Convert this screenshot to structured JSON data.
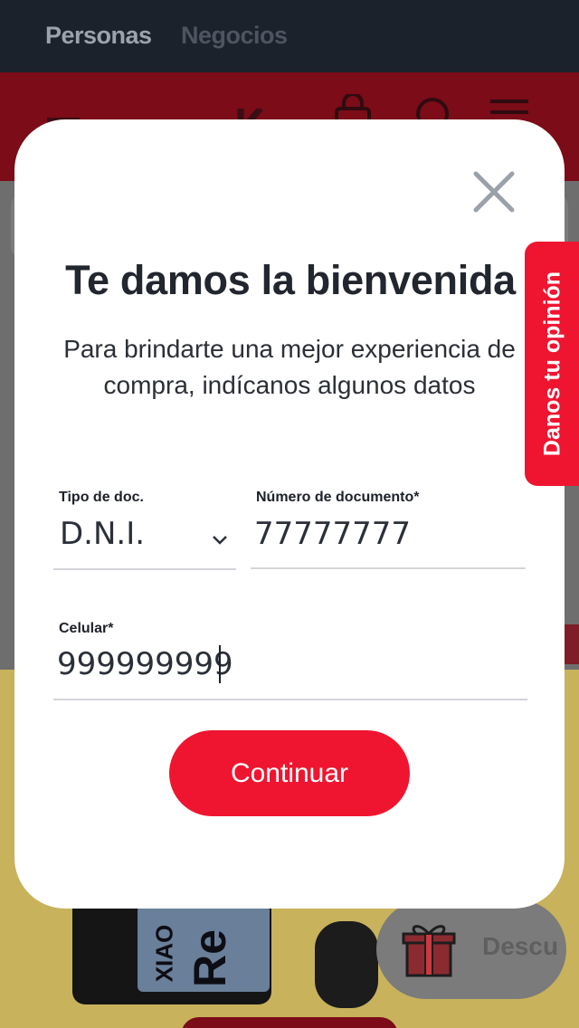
{
  "top_nav": {
    "tabs": [
      {
        "label": "Personas",
        "active": true
      },
      {
        "label": "Negocios",
        "active": false
      }
    ]
  },
  "header": {
    "icons": [
      "bag-icon",
      "search-icon",
      "menu-icon"
    ]
  },
  "modal": {
    "title": "Te damos la bienvenida",
    "subtitle": "Para brindarte una mejor experiencia de compra, indícanos algunos datos",
    "doc_type": {
      "label": "Tipo de doc.",
      "value": "D.N.I."
    },
    "doc_number": {
      "label": "Número de documento*",
      "value": "77777777"
    },
    "phone": {
      "label": "Celular*",
      "value": "999999999"
    },
    "continue_label": "Continuar"
  },
  "feedback_tab": {
    "label": "Danos tu opinión"
  },
  "promo": {
    "phone_brand": "Re",
    "phone_brand_vertical": "XIAO",
    "gift_button_text": "Descu"
  },
  "colors": {
    "brand_red": "#ef1530",
    "nav_dark": "#1b222c",
    "text_dark": "#22262e"
  }
}
